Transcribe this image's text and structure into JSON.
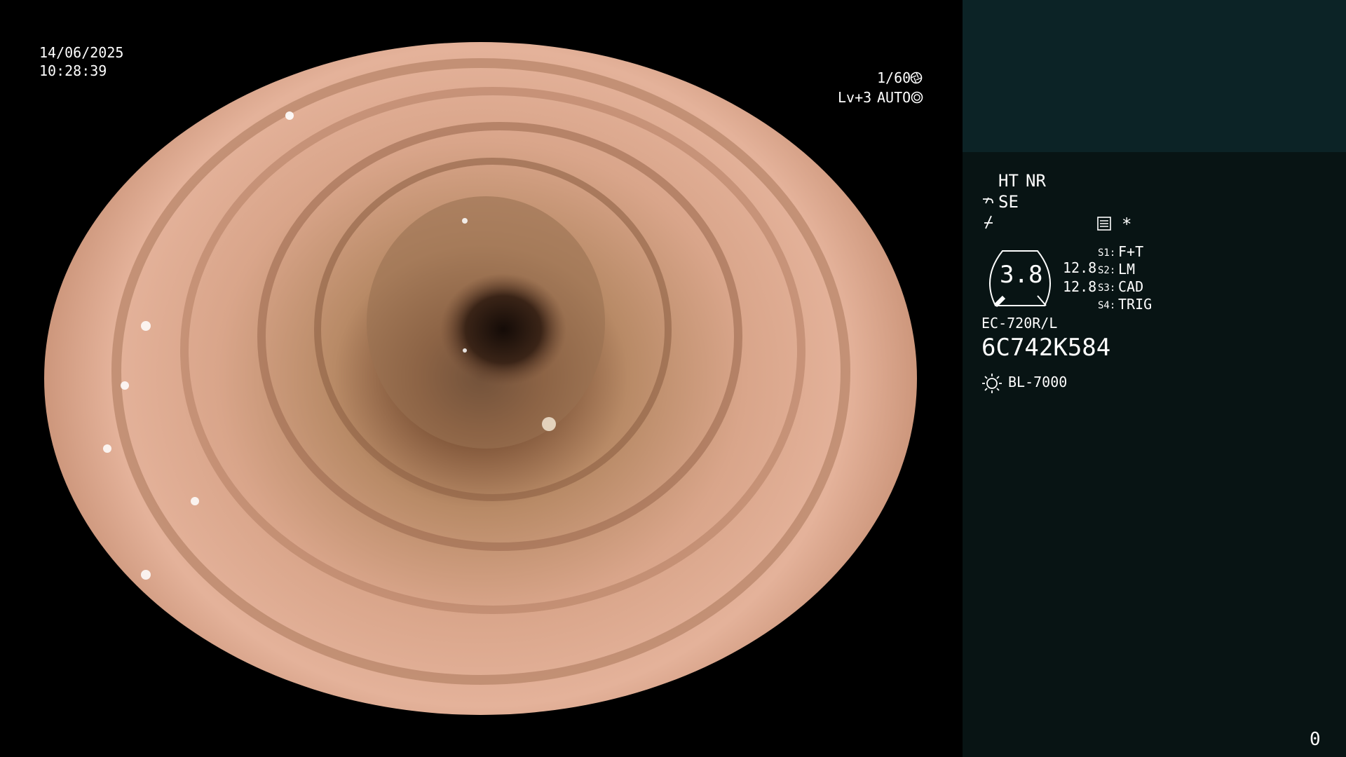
{
  "overlay": {
    "date": "14/06/2025",
    "time": "10:28:39",
    "shutter": "1/60",
    "level": "Lv+3",
    "exposure_mode": "AUTO"
  },
  "panel": {
    "ht_label": "HT",
    "nr_label": "NR",
    "se_label": "SE",
    "gauge_value": "3.8",
    "gauge_left_top": "12.8",
    "gauge_left_bottom": "12.8",
    "switches": [
      {
        "key": "S1:",
        "value": "F+T"
      },
      {
        "key": "S2:",
        "value": "LM"
      },
      {
        "key": "S3:",
        "value": "CAD"
      },
      {
        "key": "S4:",
        "value": "TRIG"
      }
    ],
    "scope_model": "EC-720R/L",
    "serial": "6C742K584",
    "light_source": "BL-7000",
    "asterisk": "*",
    "counter": "0",
    "icons": [
      "scope-bend-icon",
      "flow-icon",
      "memo-icon",
      "shutter-icon",
      "auto-iris-icon",
      "light-source-icon"
    ],
    "accent_color": "#f0a83a"
  }
}
